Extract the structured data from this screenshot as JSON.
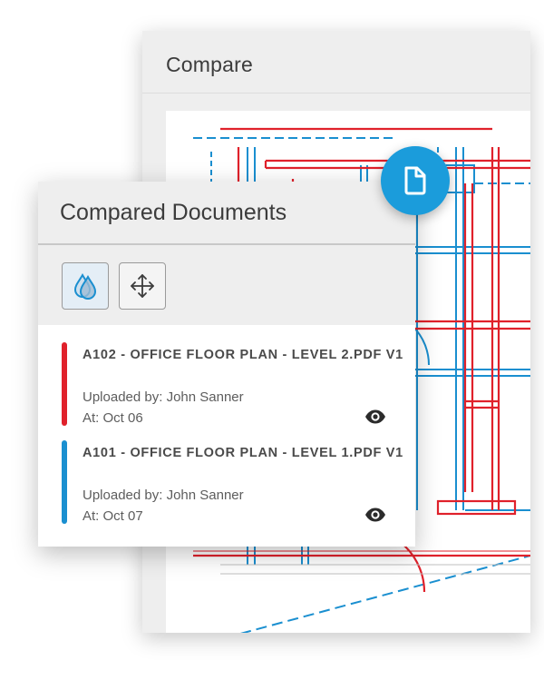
{
  "compare_window": {
    "title": "Compare"
  },
  "panel": {
    "title": "Compared Documents",
    "tools": [
      {
        "name": "overlay",
        "icon": "overlay-drops-icon"
      },
      {
        "name": "move",
        "icon": "move-arrows-icon"
      }
    ],
    "documents": [
      {
        "name": "A102 - OFFICE FLOOR PLAN - LEVEL 2.PDF V1",
        "uploaded_by": "Uploaded by: John Sanner",
        "date": "At: Oct 06",
        "color": "#e0212b",
        "icon": "eye-icon"
      },
      {
        "name": "A101 - OFFICE FLOOR PLAN - LEVEL 1.PDF V1",
        "uploaded_by": "Uploaded by: John Sanner",
        "date": "At: Oct 07",
        "color": "#1a8fd0",
        "icon": "eye-icon"
      }
    ]
  },
  "fab": {
    "icon": "document-icon",
    "color": "#1b9cdb"
  },
  "colors": {
    "red_overlay": "#e0212b",
    "blue_overlay": "#1a8fd0"
  }
}
